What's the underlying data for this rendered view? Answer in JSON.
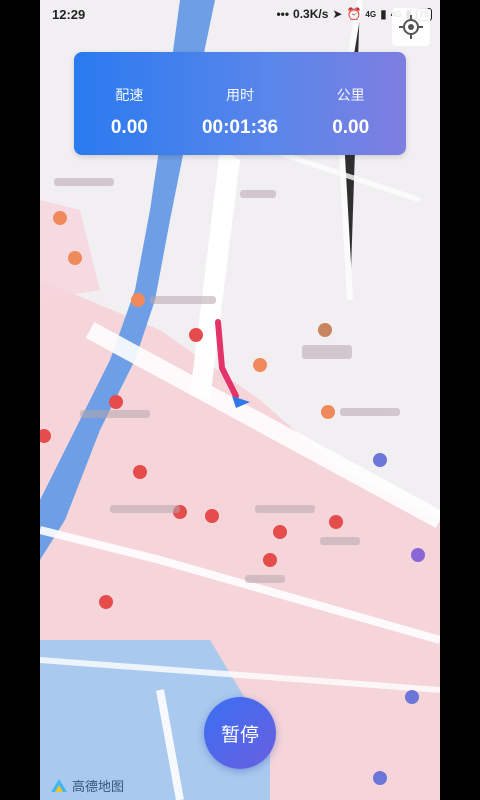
{
  "status_bar": {
    "time": "12:29",
    "net_speed": "0.3K/s",
    "signal1": "4G",
    "signal2": "4G",
    "battery": "75"
  },
  "stats": {
    "pace_label": "配速",
    "pace_value": "0.00",
    "time_label": "用时",
    "time_value": "00:01:36",
    "distance_label": "公里",
    "distance_value": "0.00"
  },
  "controls": {
    "pause_label": "暂停"
  },
  "map": {
    "logo_text": "高德地图"
  },
  "colors": {
    "card_start": "#2a7af0",
    "card_end": "#7e7ee0",
    "track": "#e2336b",
    "river": "#6ea0e6",
    "area_pink": "#f7cfd6"
  }
}
